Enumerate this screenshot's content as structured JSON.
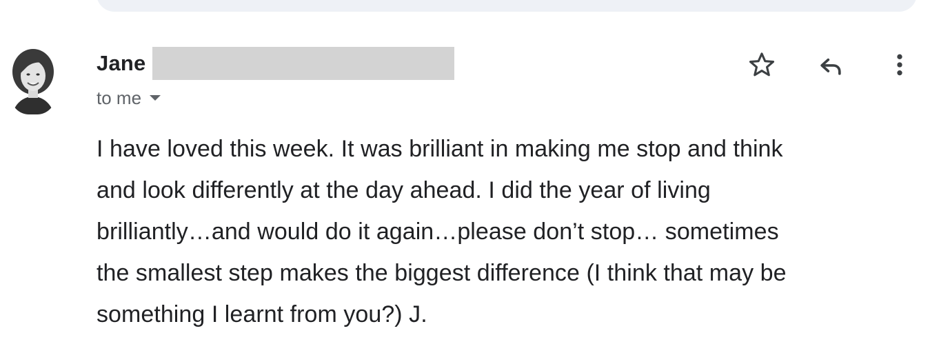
{
  "sender": {
    "name": "Jane",
    "recipient_text": "to me"
  },
  "icons": {
    "star": "star-icon",
    "reply": "reply-icon",
    "more": "more-vert-icon",
    "caret": "chevron-down-icon"
  },
  "message": {
    "lines": [
      "I have loved this week. It was brilliant in making me stop and think",
      "and look differently at the day ahead. I did the year of living",
      "brilliantly…and would do it again…please don’t stop… sometimes",
      "the smallest step makes the biggest difference (I think that may be",
      "something I learnt from you?) J."
    ]
  },
  "colors": {
    "text": "#202124",
    "secondary_text": "#5f6368",
    "redaction": "#d3d3d3",
    "top_strip": "#eef1f6"
  }
}
